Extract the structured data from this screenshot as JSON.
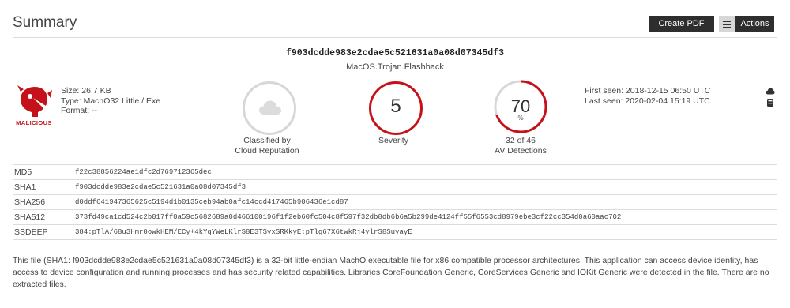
{
  "header": {
    "title": "Summary",
    "create_pdf_label": "Create PDF",
    "actions_label": "Actions"
  },
  "sample": {
    "hash": "f903dcdde983e2cdae5c521631a0a08d07345df3",
    "threat_name": "MacOS.Trojan.Flashback",
    "verdict": "MALICIOUS",
    "size": "Size: 26.7 KB",
    "type": "Type: MachO32 Little / Exe",
    "format": "Format: --"
  },
  "indicators": {
    "cloud": {
      "icon": "cloud-icon",
      "caption_line1": "Classified by",
      "caption_line2": "Cloud Reputation"
    },
    "severity": {
      "value": "5",
      "label": "Severity"
    },
    "av": {
      "value": "70",
      "unit": "%",
      "detected": 32,
      "total": 46,
      "caption_line1": "32 of 46",
      "caption_line2": "AV Detections"
    }
  },
  "dates": {
    "first_seen": "First seen: 2018-12-15 06:50 UTC",
    "last_seen": "Last seen: 2020-02-04 15:19 UTC"
  },
  "side_icons": [
    "cloud-icon",
    "database-icon"
  ],
  "hashes": [
    {
      "label": "MD5",
      "value": "f22c38856224ae1dfc2d769712365dec"
    },
    {
      "label": "SHA1",
      "value": "f903dcdde983e2cdae5c521631a0a08d07345df3"
    },
    {
      "label": "SHA256",
      "value": "d0ddf641947365625c5194d1b0135ceb94ab0afc14ccd417465b906436e1cd87"
    },
    {
      "label": "SHA512",
      "value": "373fd49ca1cd524c2b017ff0a59c5682689a0d466100196f1f2eb60fc504c8f597f32db8db6b6a5b299de4124ff55f6553cd8979ebe3cf22cc354d0a60aac702"
    },
    {
      "label": "SSDEEP",
      "value": "384:pTlA/68u3Hmr0owkHEM/ECy+4kYqYWeLKlrS8E3TSyxSRKkyE:pTlg67X6twkRj4ylrS8SuyayE"
    }
  ],
  "description": "This file (SHA1: f903dcdde983e2cdae5c521631a0a08d07345df3) is a 32-bit little-endian MachO executable file for x86 compatible processor architectures. This application can access device identity, has access to device configuration and running processes and has security related capabilities. Libraries CoreFoundation Generic, CoreServices Generic and IOKit Generic were detected in the file. There are no extracted files.",
  "colors": {
    "accent": "#c5121a",
    "button_dark": "#2e2e2e",
    "ring_grey": "#d7d7d7"
  }
}
